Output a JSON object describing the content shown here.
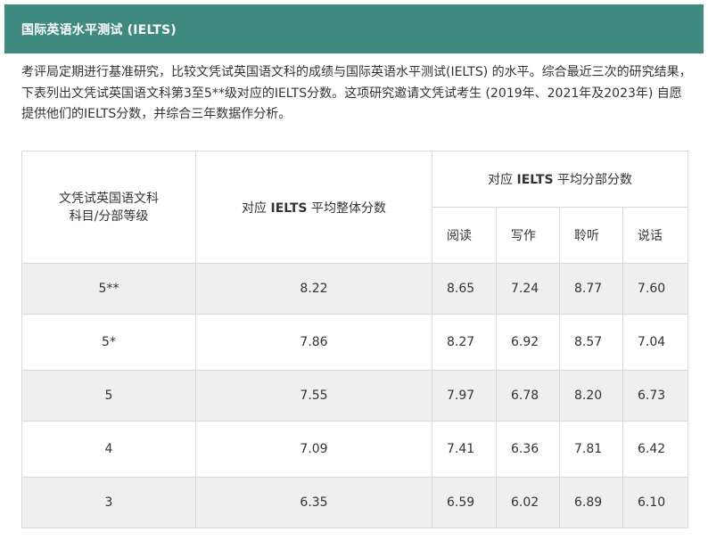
{
  "header": {
    "title": "国际英语水平测试 (IELTS)",
    "background_color": "#3f8a80"
  },
  "intro": {
    "text": "考评局定期进行基准研究，比较文凭试英国语文科的成绩与国际英语水平测试(IELTS) 的水平。综合最近三次的研究结果，下表列出文凭试英国语文科第3至5**级对应的IELTS分数。这项研究邀请文凭试考生 (2019年、2021年及2023年) 自愿提供他们的IELTS分数，并综合三年数据作分析。"
  },
  "table": {
    "headers": {
      "subject_line1": "文凭试英国语文科",
      "subject_line2": "科目/分部等级",
      "overall_prefix": "对应 ",
      "overall_strong": "IELTS",
      "overall_suffix": " 平均整体分数",
      "section_prefix": "对应 ",
      "section_strong": "IELTS",
      "section_suffix": " 平均分部分数",
      "sub": [
        "阅读",
        "写作",
        "聆听",
        "说话"
      ]
    },
    "rows": [
      {
        "level": "5**",
        "overall": "8.22",
        "reading": "8.65",
        "writing": "7.24",
        "listening": "8.77",
        "speaking": "7.60"
      },
      {
        "level": "5*",
        "overall": "7.86",
        "reading": "8.27",
        "writing": "6.92",
        "listening": "8.57",
        "speaking": "7.04"
      },
      {
        "level": "5",
        "overall": "7.55",
        "reading": "7.97",
        "writing": "6.78",
        "listening": "8.20",
        "speaking": "6.73"
      },
      {
        "level": "4",
        "overall": "7.09",
        "reading": "7.41",
        "writing": "6.36",
        "listening": "7.81",
        "speaking": "6.42"
      },
      {
        "level": "3",
        "overall": "6.35",
        "reading": "6.59",
        "writing": "6.02",
        "listening": "6.89",
        "speaking": "6.10"
      }
    ],
    "shaded_row_color": "#efefef",
    "border_color": "#d9d9d9"
  }
}
